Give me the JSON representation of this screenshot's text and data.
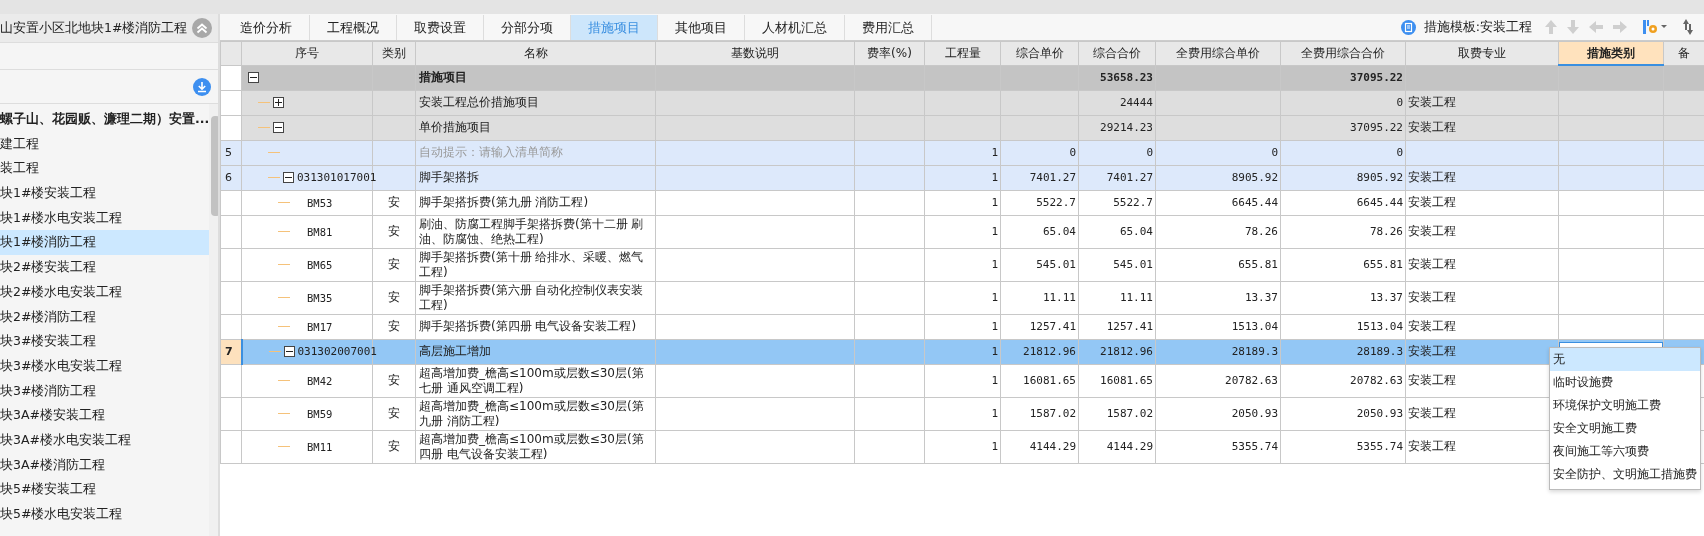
{
  "sidebar": {
    "title": "山安置小区北地块1#楼消防工程",
    "tree": {
      "label": "螺子山、花园贩、濂理二期）安置...",
      "selected": false,
      "children": [
        {
          "label": "建工程",
          "selected": false
        },
        {
          "label": "装工程",
          "selected": false
        },
        {
          "label": "块1#楼安装工程",
          "selected": false
        },
        {
          "label": "块1#楼水电安装工程",
          "selected": false
        },
        {
          "label": "块1#楼消防工程",
          "selected": true
        },
        {
          "label": "块2#楼安装工程",
          "selected": false
        },
        {
          "label": "块2#楼水电安装工程",
          "selected": false
        },
        {
          "label": "块2#楼消防工程",
          "selected": false
        },
        {
          "label": "块3#楼安装工程",
          "selected": false
        },
        {
          "label": "块3#楼水电安装工程",
          "selected": false
        },
        {
          "label": "块3#楼消防工程",
          "selected": false
        },
        {
          "label": "块3A#楼安装工程",
          "selected": false
        },
        {
          "label": "块3A#楼水电安装工程",
          "selected": false
        },
        {
          "label": "块3A#楼消防工程",
          "selected": false
        },
        {
          "label": "块5#楼安装工程",
          "selected": false
        },
        {
          "label": "块5#楼水电安装工程",
          "selected": false
        }
      ]
    }
  },
  "tabs": [
    {
      "label": "造价分析",
      "selected": false
    },
    {
      "label": "工程概况",
      "selected": false
    },
    {
      "label": "取费设置",
      "selected": false
    },
    {
      "label": "分部分项",
      "selected": false
    },
    {
      "label": "措施项目",
      "selected": true
    },
    {
      "label": "其他项目",
      "selected": false
    },
    {
      "label": "人材机汇总",
      "selected": false
    },
    {
      "label": "费用汇总",
      "selected": false
    }
  ],
  "toolbar": {
    "template_label": "措施模板:安装工程",
    "buttons": [
      {
        "kind": "up",
        "disabled": true
      },
      {
        "kind": "down",
        "disabled": true
      },
      {
        "kind": "left",
        "disabled": true
      },
      {
        "kind": "right",
        "disabled": true
      },
      {
        "kind": "settings",
        "disabled": false
      },
      {
        "kind": "sort",
        "disabled": false
      }
    ]
  },
  "table": {
    "columns": [
      {
        "selected": false
      },
      {
        "label": "序号",
        "selected": false
      },
      {
        "label": "类别",
        "selected": false
      },
      {
        "label": "名称",
        "selected": false
      },
      {
        "label": "基数说明",
        "selected": false
      },
      {
        "label": "费率(%)",
        "selected": false
      },
      {
        "label": "工程量",
        "selected": false
      },
      {
        "label": "综合单价",
        "selected": false
      },
      {
        "label": "综合合价",
        "selected": false
      },
      {
        "label": "全费用综合单价",
        "selected": false
      },
      {
        "label": "全费用综合合价",
        "selected": false
      },
      {
        "label": "取费专业",
        "selected": false
      },
      {
        "label": "措施类别",
        "selected": true
      },
      {
        "label": "备",
        "selected": false
      }
    ],
    "rows": [
      {
        "kind": "summary",
        "expanded": true,
        "selected": false,
        "name": "措施项目",
        "total_price": "53658.23",
        "full_total_price": "37095.22",
        "children": [
          {
            "kind": "group",
            "expanded": false,
            "selected": false,
            "name": "安装工程总价措施项目",
            "total_price": "24444",
            "full_total_price": "0",
            "fee_specialty": "安装工程"
          },
          {
            "kind": "group",
            "expanded": true,
            "selected": false,
            "name": "单价措施项目",
            "total_price": "29214.23",
            "full_total_price": "37095.22",
            "fee_specialty": "安装工程",
            "children": [
              {
                "kind": "hint",
                "selected": false,
                "number": "5",
                "name": "自动提示：请输入清单简称",
                "quantity": "1",
                "unit_price": "0",
                "total_price": "0",
                "full_unit_price": "0",
                "full_total_price": "0"
              },
              {
                "kind": "measure",
                "expanded": true,
                "selected": false,
                "number": "6",
                "code": "031301017001",
                "name": "脚手架搭拆",
                "quantity": "1",
                "unit_price": "7401.27",
                "total_price": "7401.27",
                "full_unit_price": "8905.92",
                "full_total_price": "8905.92",
                "fee_specialty": "安装工程",
                "children": [
                  {
                    "kind": "sub",
                    "selected": false,
                    "code": "BM53",
                    "category": "安",
                    "name": "脚手架搭拆费(第九册 消防工程)",
                    "quantity": "1",
                    "unit_price": "5522.7",
                    "total_price": "5522.7",
                    "full_unit_price": "6645.44",
                    "full_total_price": "6645.44",
                    "fee_specialty": "安装工程"
                  },
                  {
                    "kind": "sub",
                    "selected": false,
                    "code": "BM81",
                    "category": "安",
                    "name": "刷油、防腐工程脚手架搭拆费(第十二册 刷油、防腐蚀、绝热工程)",
                    "quantity": "1",
                    "unit_price": "65.04",
                    "total_price": "65.04",
                    "full_unit_price": "78.26",
                    "full_total_price": "78.26",
                    "fee_specialty": "安装工程"
                  },
                  {
                    "kind": "sub",
                    "selected": false,
                    "code": "BM65",
                    "category": "安",
                    "name": "脚手架搭拆费(第十册 给排水、采暖、燃气工程)",
                    "quantity": "1",
                    "unit_price": "545.01",
                    "total_price": "545.01",
                    "full_unit_price": "655.81",
                    "full_total_price": "655.81",
                    "fee_specialty": "安装工程"
                  },
                  {
                    "kind": "sub",
                    "selected": false,
                    "code": "BM35",
                    "category": "安",
                    "name": "脚手架搭拆费(第六册 自动化控制仪表安装工程)",
                    "quantity": "1",
                    "unit_price": "11.11",
                    "total_price": "11.11",
                    "full_unit_price": "13.37",
                    "full_total_price": "13.37",
                    "fee_specialty": "安装工程"
                  },
                  {
                    "kind": "sub",
                    "selected": false,
                    "code": "BM17",
                    "category": "安",
                    "name": "脚手架搭拆费(第四册 电气设备安装工程)",
                    "quantity": "1",
                    "unit_price": "1257.41",
                    "total_price": "1257.41",
                    "full_unit_price": "1513.04",
                    "full_total_price": "1513.04",
                    "fee_specialty": "安装工程"
                  }
                ]
              },
              {
                "kind": "measure",
                "expanded": true,
                "selected": true,
                "number": "7",
                "code": "031302007001",
                "name": "高层施工增加",
                "quantity": "1",
                "unit_price": "21812.96",
                "total_price": "21812.96",
                "full_unit_price": "28189.3",
                "full_total_price": "28189.3",
                "fee_specialty": "安装工程",
                "measure_type_dropdown": {
                  "open": true,
                  "options": [
                    {
                      "label": "无",
                      "selected": true
                    },
                    {
                      "label": "临时设施费",
                      "selected": false
                    },
                    {
                      "label": "环境保护文明施工费",
                      "selected": false
                    },
                    {
                      "label": "安全文明施工费",
                      "selected": false
                    },
                    {
                      "label": "夜间施工等六项费",
                      "selected": false
                    },
                    {
                      "label": "安全防护、文明施工措施费",
                      "selected": false
                    }
                  ]
                },
                "children": [
                  {
                    "kind": "sub",
                    "selected": false,
                    "code": "BM42",
                    "category": "安",
                    "name": "超高增加费_檐高≤100m或层数≤30层(第七册 通风空调工程)",
                    "quantity": "1",
                    "unit_price": "16081.65",
                    "total_price": "16081.65",
                    "full_unit_price": "20782.63",
                    "full_total_price": "20782.63",
                    "fee_specialty": "安装工程"
                  },
                  {
                    "kind": "sub",
                    "selected": false,
                    "code": "BM59",
                    "category": "安",
                    "name": "超高增加费_檐高≤100m或层数≤30层(第九册 消防工程)",
                    "quantity": "1",
                    "unit_price": "1587.02",
                    "total_price": "1587.02",
                    "full_unit_price": "2050.93",
                    "full_total_price": "2050.93",
                    "fee_specialty": "安装工程"
                  },
                  {
                    "kind": "sub",
                    "selected": false,
                    "code": "BM11",
                    "category": "安",
                    "name": "超高增加费_檐高≤100m或层数≤30层(第四册 电气设备安装工程)",
                    "quantity": "1",
                    "unit_price": "4144.29",
                    "total_price": "4144.29",
                    "full_unit_price": "5355.74",
                    "full_total_price": "5355.74",
                    "fee_specialty": "安装工程"
                  }
                ]
              }
            ]
          }
        ]
      }
    ]
  }
}
